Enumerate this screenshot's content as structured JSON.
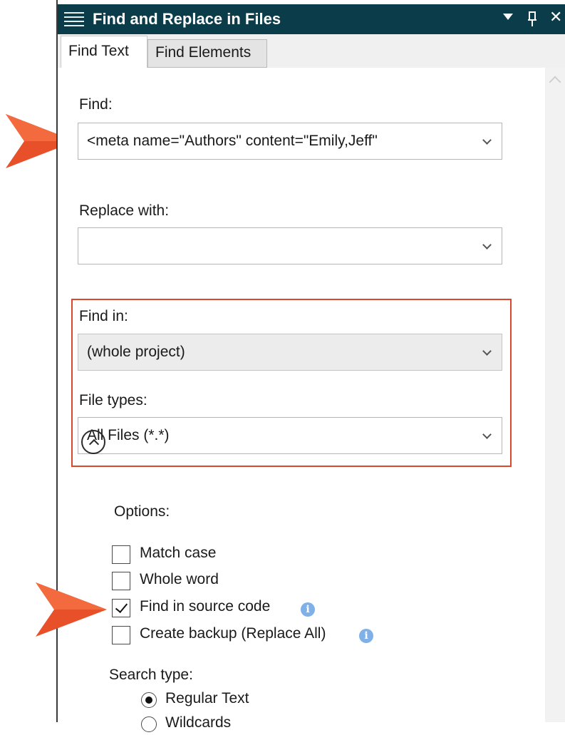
{
  "window": {
    "title": "Find and Replace in Files",
    "close_glyph": "✕"
  },
  "tabs": [
    {
      "label": "Find Text",
      "active": true
    },
    {
      "label": "Find Elements",
      "active": false
    }
  ],
  "find": {
    "label": "Find:",
    "value": "<meta name=\"Authors\" content=\"Emily,Jeff\""
  },
  "replace": {
    "label": "Replace with:",
    "value": ""
  },
  "find_in": {
    "label": "Find in:",
    "value": "(whole project)"
  },
  "file_types": {
    "label": "File types:",
    "value": "All Files (*.*)"
  },
  "options": {
    "label": "Options:",
    "expanded": true,
    "checkboxes": [
      {
        "label": "Match case",
        "checked": false,
        "info": false
      },
      {
        "label": "Whole word",
        "checked": false,
        "info": false
      },
      {
        "label": "Find in source code",
        "checked": true,
        "info": true
      },
      {
        "label": "Create backup (Replace All)",
        "checked": false,
        "info": true
      }
    ]
  },
  "search_type": {
    "label": "Search type:",
    "options": [
      {
        "label": "Regular Text",
        "selected": true
      },
      {
        "label": "Wildcards",
        "selected": false
      }
    ]
  },
  "info_glyph": "i",
  "colors": {
    "titlebar": "#0b3c4a",
    "highlight_box": "#d9482b",
    "callout_arrow": "#e8502a",
    "info_icon": "#7fb0e8"
  },
  "icons": [
    "menu-icon",
    "dropdown-arrow-icon",
    "pin-icon",
    "close-icon",
    "chevron-down-icon",
    "collapse-up-icon",
    "checkmark-icon",
    "info-icon",
    "callout-arrow-icon"
  ]
}
